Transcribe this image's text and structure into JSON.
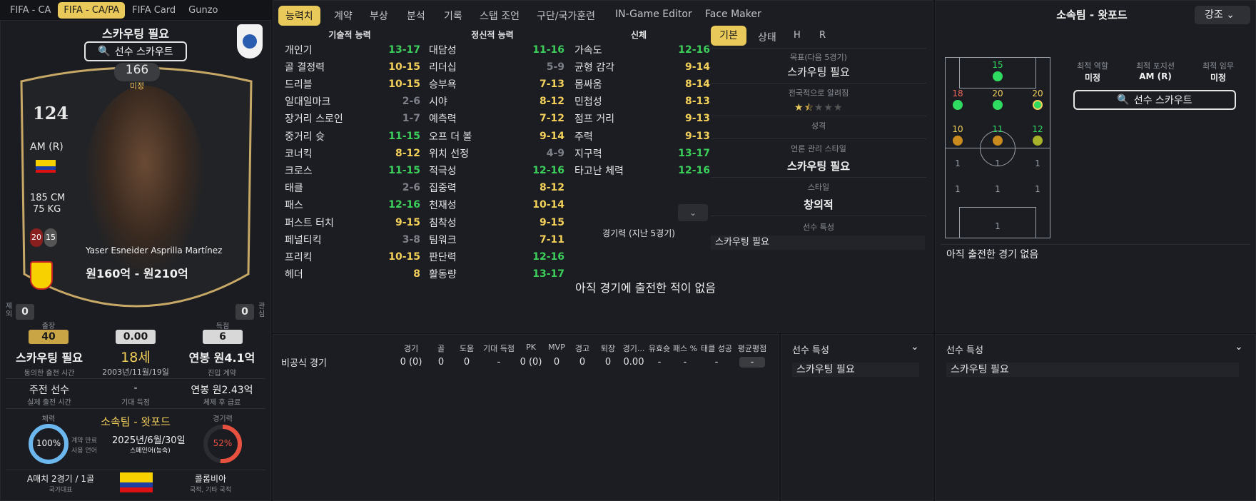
{
  "top_tabs": [
    "FIFA - CA",
    "FIFA - CA/PA",
    "FIFA Card",
    "Gunzo"
  ],
  "left": {
    "status_title": "스카우팅 필요",
    "scout_button": "선수 스카우트",
    "card": {
      "ability": "166",
      "ability_label": "미정",
      "rating": "124",
      "position": "AM (R)",
      "height": "185 CM",
      "weight": "75 KG",
      "age_badge": "20",
      "num_badge": "15",
      "player_name": "Yaser Esneider Asprilla Martínez",
      "value_range": "원160억 - 원210억",
      "left_side_label": "제외",
      "left_side_count": "0",
      "right_side_label": "관심",
      "right_side_count": "0"
    },
    "stats": {
      "apps_label": "출장",
      "apps": "40",
      "rating": "0.00",
      "goals_label": "득점",
      "goals": "6"
    },
    "info": {
      "status": "스카우팅 필요",
      "status_sub": "동의한 출전 시간",
      "age": "18세",
      "dob": "2003년/11월/19일",
      "wage": "연봉 원4.1억",
      "wage_sub": "진입 계약",
      "role": "주전 선수",
      "role_sub": "실제 출전 시간",
      "expected": "-",
      "expected_sub": "기대 득점",
      "release": "연봉 원2.43억",
      "release_sub": "체제 후 급료"
    },
    "club": {
      "fitness_label": "체력",
      "fitness": "100%",
      "contract_label": "계약 만료",
      "language_label": "사용 언어",
      "club_name": "소속팀 - 왓포드",
      "contract_end": "2025년/6월/30일",
      "language": "스페인어(능숙)",
      "form_label": "경기력",
      "form": "52%",
      "form_fraction": 0.52
    },
    "intl": {
      "caps": "A매치 2경기 / 1골",
      "caps_sub": "국가대표",
      "nation": "콜롬비아",
      "nation_sub": "국적, 기타 국적"
    }
  },
  "mid_tabs": [
    "능력치",
    "계약",
    "부상",
    "분석",
    "기록",
    "스탭 조언",
    "구단/국가훈련",
    "IN-Game Editor",
    "Face Maker"
  ],
  "attributes": {
    "technical_title": "기술적 능력",
    "mental_title": "정신적 능력",
    "physical_title": "신체",
    "technical": [
      {
        "name": "개인기",
        "value": "13-17",
        "c": "g"
      },
      {
        "name": "골 결정력",
        "value": "10-15",
        "c": "y"
      },
      {
        "name": "드리블",
        "value": "10-15",
        "c": "y"
      },
      {
        "name": "일대일마크",
        "value": "2-6",
        "c": "gr"
      },
      {
        "name": "장거리 스로인",
        "value": "1-7",
        "c": "gr"
      },
      {
        "name": "중거리 슛",
        "value": "11-15",
        "c": "g"
      },
      {
        "name": "코너킥",
        "value": "8-12",
        "c": "y"
      },
      {
        "name": "크로스",
        "value": "11-15",
        "c": "g"
      },
      {
        "name": "태클",
        "value": "2-6",
        "c": "gr"
      },
      {
        "name": "패스",
        "value": "12-16",
        "c": "g"
      },
      {
        "name": "퍼스트 터치",
        "value": "9-15",
        "c": "y"
      },
      {
        "name": "페널티킥",
        "value": "3-8",
        "c": "gr"
      },
      {
        "name": "프리킥",
        "value": "10-15",
        "c": "y"
      },
      {
        "name": "헤더",
        "value": "8",
        "c": "y"
      }
    ],
    "mental": [
      {
        "name": "대담성",
        "value": "11-16",
        "c": "g"
      },
      {
        "name": "리더십",
        "value": "5-9",
        "c": "gr"
      },
      {
        "name": "승부욕",
        "value": "7-13",
        "c": "y"
      },
      {
        "name": "시야",
        "value": "8-12",
        "c": "y"
      },
      {
        "name": "예측력",
        "value": "7-12",
        "c": "y"
      },
      {
        "name": "오프 더 볼",
        "value": "9-14",
        "c": "y"
      },
      {
        "name": "위치 선정",
        "value": "4-9",
        "c": "gr"
      },
      {
        "name": "적극성",
        "value": "12-16",
        "c": "g"
      },
      {
        "name": "집중력",
        "value": "8-12",
        "c": "y"
      },
      {
        "name": "천재성",
        "value": "10-14",
        "c": "y"
      },
      {
        "name": "침착성",
        "value": "9-15",
        "c": "y"
      },
      {
        "name": "팀워크",
        "value": "7-11",
        "c": "y"
      },
      {
        "name": "판단력",
        "value": "12-16",
        "c": "g"
      },
      {
        "name": "활동량",
        "value": "13-17",
        "c": "g"
      }
    ],
    "physical": [
      {
        "name": "가속도",
        "value": "12-16",
        "c": "g"
      },
      {
        "name": "균형 감각",
        "value": "9-14",
        "c": "y"
      },
      {
        "name": "몸싸움",
        "value": "8-14",
        "c": "y"
      },
      {
        "name": "민첩성",
        "value": "8-13",
        "c": "y"
      },
      {
        "name": "점프 거리",
        "value": "9-13",
        "c": "y"
      },
      {
        "name": "주력",
        "value": "9-13",
        "c": "y"
      },
      {
        "name": "지구력",
        "value": "13-17",
        "c": "g"
      },
      {
        "name": "타고난 체력",
        "value": "12-16",
        "c": "g"
      }
    ],
    "form_title": "경기력 (지난 5경기)",
    "no_matches": "아직 경기에 출전한 적이 없음"
  },
  "basic_panel": {
    "tabs": [
      "기본",
      "상태",
      "H",
      "R"
    ],
    "target_label": "목표(다음 5경기)",
    "target_value": "스카우팅 필요",
    "known_label": "전국적으로 알려짐",
    "stars": 1.5,
    "personality_label": "성격",
    "media_label": "언론 관리 스타일",
    "media_value": "스카우팅 필요",
    "style_label": "스타일",
    "style_value": "창의적",
    "traits_label": "선수 특성",
    "traits_value": "스카우팅 필요"
  },
  "right": {
    "title": "소속팀 - 왓포드",
    "emphasis": "강조",
    "best_role_label": "최적 역할",
    "best_role": "미정",
    "best_pos_label": "최적 포지션",
    "best_pos": "AM (R)",
    "best_duty_label": "최적 임무",
    "best_duty": "미정",
    "scout_button": "선수 스카우트",
    "no_matches": "아직 출전한 경기 없음",
    "pitch_numbers": [
      "15",
      "18",
      "20",
      "20",
      "10",
      "11",
      "12",
      "1",
      "1",
      "1",
      "1",
      "1",
      "1",
      "1"
    ]
  },
  "bottom": {
    "headers": [
      "경기",
      "골",
      "도움",
      "기대 득점",
      "PK",
      "MVP",
      "경고",
      "퇴장",
      "경기...",
      "유효슛",
      "패스 %",
      "태클 성공",
      "평균평점"
    ],
    "row_label": "비공식 경기",
    "row": [
      "0 (0)",
      "0",
      "0",
      "-",
      "0 (0)",
      "0",
      "0",
      "0",
      "0.00",
      "-",
      "-",
      "-",
      "-"
    ],
    "traits1_title": "선수 특성",
    "traits1_value": "스카우팅 필요",
    "traits2_title": "선수 특성",
    "traits2_value": "스카우팅 필요"
  },
  "colors": {
    "accent": "#e9c95a",
    "green": "#3ccf5a",
    "gold": "#f3d05a",
    "grey": "#7d8088"
  }
}
